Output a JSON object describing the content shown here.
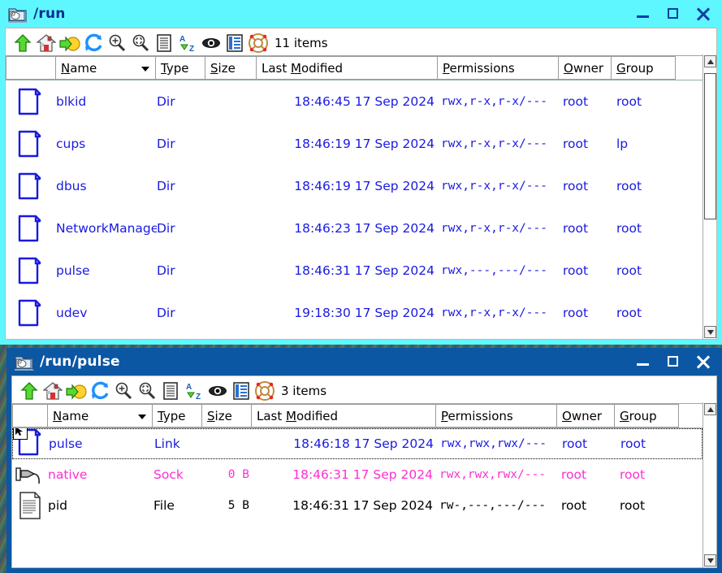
{
  "windows": [
    {
      "title": "/run",
      "title_icon": "folder-bird-icon",
      "item_count_label": "11 items",
      "toolbar": [
        {
          "name": "up-arrow-icon",
          "label": "Up"
        },
        {
          "name": "home-icon",
          "label": "Home"
        },
        {
          "name": "forward-folder-icon",
          "label": "Go"
        },
        {
          "name": "refresh-icon",
          "label": "Refresh"
        },
        {
          "name": "zoom-in-icon",
          "label": "Zoom In"
        },
        {
          "name": "zoom-fit-icon",
          "label": "Zoom Fit"
        },
        {
          "name": "list-view-icon",
          "label": "List View"
        },
        {
          "name": "sort-az-icon",
          "label": "Sort A-Z"
        },
        {
          "name": "show-hidden-eye-icon",
          "label": "Show Hidden"
        },
        {
          "name": "detail-view-icon",
          "label": "Detail View"
        },
        {
          "name": "lifebuoy-help-icon",
          "label": "Help"
        }
      ],
      "columns": [
        {
          "key": "icon",
          "label": "",
          "accel": ""
        },
        {
          "key": "name",
          "label": "Name",
          "accel": "N",
          "sorted": true
        },
        {
          "key": "type",
          "label": "Type",
          "accel": "T"
        },
        {
          "key": "size",
          "label": "Size",
          "accel": "S"
        },
        {
          "key": "modified",
          "label": "Last Modified",
          "accel": "M"
        },
        {
          "key": "permissions",
          "label": "Permissions",
          "accel": "P"
        },
        {
          "key": "owner",
          "label": "Owner",
          "accel": "O"
        },
        {
          "key": "group",
          "label": "Group",
          "accel": "G"
        }
      ],
      "rows": [
        {
          "icon": "folder-icon",
          "name": "blkid",
          "type": "Dir",
          "size": "",
          "modified": "18:46:45 17 Sep 2024",
          "permissions": "rwx,r-x,r-x/---",
          "owner": "root",
          "group": "root",
          "color": "#1a1ae0",
          "selected": false
        },
        {
          "icon": "folder-icon",
          "name": "cups",
          "type": "Dir",
          "size": "",
          "modified": "18:46:19 17 Sep 2024",
          "permissions": "rwx,r-x,r-x/---",
          "owner": "root",
          "group": "lp",
          "color": "#1a1ae0",
          "selected": false
        },
        {
          "icon": "folder-icon",
          "name": "dbus",
          "type": "Dir",
          "size": "",
          "modified": "18:46:19 17 Sep 2024",
          "permissions": "rwx,r-x,r-x/---",
          "owner": "root",
          "group": "root",
          "color": "#1a1ae0",
          "selected": false
        },
        {
          "icon": "folder-icon",
          "name": "NetworkManager",
          "type": "Dir",
          "size": "",
          "modified": "18:46:23 17 Sep 2024",
          "permissions": "rwx,r-x,r-x/---",
          "owner": "root",
          "group": "root",
          "color": "#1a1ae0",
          "selected": false
        },
        {
          "icon": "folder-icon",
          "name": "pulse",
          "type": "Dir",
          "size": "",
          "modified": "18:46:31 17 Sep 2024",
          "permissions": "rwx,---,---/---",
          "owner": "root",
          "group": "root",
          "color": "#1a1ae0",
          "selected": false
        },
        {
          "icon": "folder-icon",
          "name": "udev",
          "type": "Dir",
          "size": "",
          "modified": "19:18:30 17 Sep 2024",
          "permissions": "rwx,r-x,r-x/---",
          "owner": "root",
          "group": "root",
          "color": "#1a1ae0",
          "selected": false
        }
      ],
      "scrollbar": {
        "thumb_top_pct": 2,
        "thumb_height_pct": 57
      }
    },
    {
      "title": "/run/pulse",
      "title_icon": "folder-bird-icon",
      "item_count_label": "3 items",
      "columns": [
        {
          "key": "icon",
          "label": "",
          "accel": ""
        },
        {
          "key": "name",
          "label": "Name",
          "accel": "N",
          "sorted": true
        },
        {
          "key": "type",
          "label": "Type",
          "accel": "T"
        },
        {
          "key": "size",
          "label": "Size",
          "accel": "S"
        },
        {
          "key": "modified",
          "label": "Last Modified",
          "accel": "M"
        },
        {
          "key": "permissions",
          "label": "Permissions",
          "accel": "P"
        },
        {
          "key": "owner",
          "label": "Owner",
          "accel": "O"
        },
        {
          "key": "group",
          "label": "Group",
          "accel": "G"
        }
      ],
      "rows": [
        {
          "icon": "folder-link-icon",
          "name": "pulse",
          "type": "Link",
          "size": "",
          "modified": "18:46:18 17 Sep 2024",
          "permissions": "rwx,rwx,rwx/---",
          "owner": "root",
          "group": "root",
          "color": "#1a1ae0",
          "selected": true
        },
        {
          "icon": "socket-plug-icon",
          "name": "native",
          "type": "Sock",
          "size": "0 B",
          "modified": "18:46:31 17 Sep 2024",
          "permissions": "rwx,rwx,rwx/---",
          "owner": "root",
          "group": "root",
          "color": "#ff2fd0",
          "selected": false
        },
        {
          "icon": "document-icon",
          "name": "pid",
          "type": "File",
          "size": "5 B",
          "modified": "18:46:31 17 Sep 2024",
          "permissions": "rw-,---,---/---",
          "owner": "root",
          "group": "root",
          "color": "#000000",
          "selected": false
        }
      ],
      "scrollbar": {
        "thumb_top_pct": 0,
        "thumb_height_pct": 0
      }
    }
  ],
  "window_buttons": {
    "minimize": "Minimize",
    "maximize": "Maximize",
    "close": "Close"
  },
  "colors": {
    "active_titlebar": "#5ff7ff",
    "inactive_titlebar": "#0b57a4",
    "dir_text": "#1a1ae0",
    "sock_text": "#ff2fd0",
    "file_text": "#000000"
  }
}
